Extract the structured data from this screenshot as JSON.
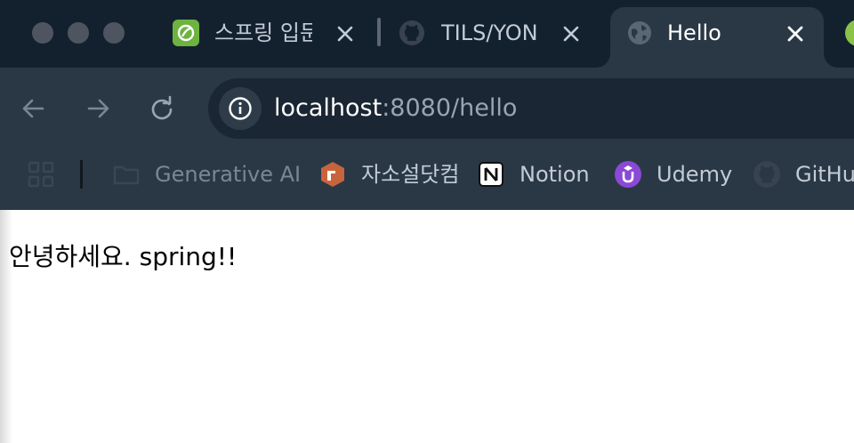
{
  "window": {
    "traffic_lights": [
      "close",
      "minimize",
      "zoom"
    ]
  },
  "tabs": [
    {
      "title": "스프링 입문",
      "favicon": "spring-icon",
      "active": false
    },
    {
      "title": "TILS/YON",
      "favicon": "github-icon",
      "active": false
    },
    {
      "title": "Hello",
      "favicon": "globe-icon",
      "active": true
    }
  ],
  "address_bar": {
    "host": "localhost",
    "rest": ":8080/hello"
  },
  "bookmarks": [
    {
      "label": "Generative AI",
      "icon": "folder-icon"
    },
    {
      "label": "자소설닷컴",
      "icon": "jasoseol-icon"
    },
    {
      "label": "Notion",
      "icon": "notion-icon"
    },
    {
      "label": "Udemy",
      "icon": "udemy-icon"
    },
    {
      "label": "GitHub",
      "icon": "github-icon"
    }
  ],
  "page": {
    "body_text": "안녕하세요. spring!!"
  },
  "colors": {
    "tabstrip_bg": "#13212f",
    "toolbar_bg": "#2a3846",
    "omnibox_bg": "#1a2633",
    "spring_green": "#6db33f",
    "udemy_purple": "#8a49d6"
  }
}
